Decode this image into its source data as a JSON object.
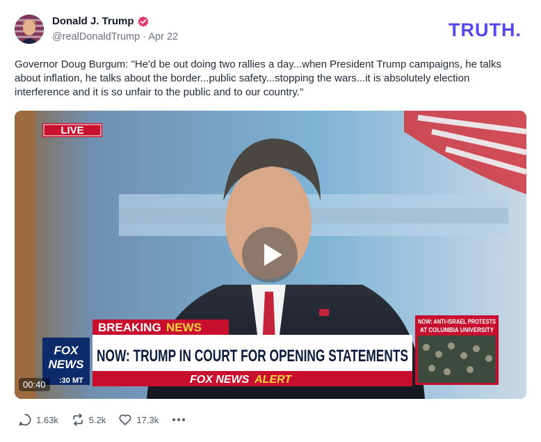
{
  "author": {
    "name": "Donald J. Trump",
    "handle": "@realDonaldTrump",
    "separator": "·",
    "date": "Apr 22",
    "verified_color": "#e23c6f"
  },
  "brand": {
    "logo_text": "TRUTH.",
    "logo_color": "#5448ee"
  },
  "post": {
    "text": "Governor Doug Burgum: \"He'd be out doing two rallies a day...when President Trump campaigns, he talks about inflation, he talks about the border...public safety...stopping the wars...it is absolutely election interference and it is so unfair to the public and to our country.\""
  },
  "video": {
    "live_label": "LIVE",
    "breaking_word": "BREAKING",
    "news_word": "NEWS",
    "headline": "NOW: TRUMP IN COURT FOR OPENING STATEMENTS",
    "alert_prefix": "FOX NEWS",
    "alert_word": "ALERT",
    "side_line1": "NOW: ANTI-ISRAEL PROTESTS",
    "side_line2": "AT COLUMBIA UNIVERSITY",
    "network_line1": "FOX",
    "network_line2": "NEWS",
    "time_label": ":30 MT",
    "duration": "00:40"
  },
  "actions": {
    "replies": "1.63k",
    "retruths": "5.2k",
    "likes": "17.3k"
  },
  "icons": [
    "verified-badge-icon",
    "reply-icon",
    "retruth-icon",
    "like-icon",
    "more-icon",
    "play-icon"
  ]
}
